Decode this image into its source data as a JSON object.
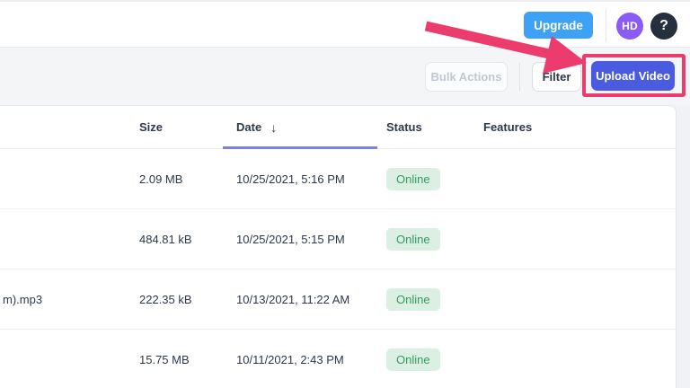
{
  "header": {
    "upgrade_label": "Upgrade",
    "avatar_initials": "HD",
    "help_glyph": "?"
  },
  "toolbar": {
    "bulk_actions_label": "Bulk Actions",
    "filter_label": "Filter",
    "upload_label": "Upload Video"
  },
  "table": {
    "columns": {
      "size": "Size",
      "date": "Date",
      "status": "Status",
      "features": "Features"
    },
    "sort_icon": "↓",
    "sorted_column": "date",
    "rows": [
      {
        "name": "",
        "size": "2.09 MB",
        "date": "10/25/2021, 5:16 PM",
        "status": "Online",
        "features": ""
      },
      {
        "name": "",
        "size": "484.81 kB",
        "date": "10/25/2021, 5:15 PM",
        "status": "Online",
        "features": ""
      },
      {
        "name": "m).mp3",
        "size": "222.35 kB",
        "date": "10/13/2021, 11:22 AM",
        "status": "Online",
        "features": ""
      },
      {
        "name": "",
        "size": "15.75 MB",
        "date": "10/11/2021, 2:43 PM",
        "status": "Online",
        "features": ""
      }
    ]
  },
  "colors": {
    "upgrade_blue": "#3DA1F5",
    "avatar_purple": "#8A5CF5",
    "help_dark": "#252F3D",
    "upload_indigo": "#4B5BE0",
    "annotation_pink": "#EC3B6D",
    "badge_bg": "#DCEFE3",
    "badge_text": "#359A62",
    "sort_underline": "#7A81EF",
    "toolbar_bg": "#F4F5F7"
  }
}
